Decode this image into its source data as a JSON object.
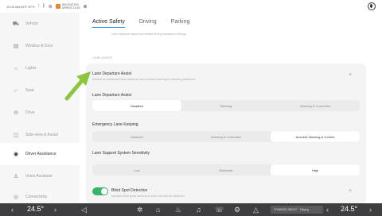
{
  "status_bar": {
    "time_info": "10:30 AM 68°F 87% ",
    "nav_line1": "NAVIGATION",
    "nav_line2": "ARRIVE 10:52"
  },
  "sidebar": {
    "items": [
      {
        "label": "Vehicle",
        "icon": "car-icon"
      },
      {
        "label": "Window & Door",
        "icon": "window-icon"
      },
      {
        "label": "Lights",
        "icon": "light-icon"
      },
      {
        "label": "Seat",
        "icon": "seat-icon"
      },
      {
        "label": "Drive",
        "icon": "steering-icon"
      },
      {
        "label": "Side-view & Assist",
        "icon": "camera-icon"
      },
      {
        "label": "Driver Assistance",
        "icon": "assist-icon",
        "active": true
      },
      {
        "label": "Voice Assistant",
        "icon": "voice-icon"
      },
      {
        "label": "Connectivity",
        "icon": "wifi-icon"
      }
    ]
  },
  "tabs": [
    "Active Safety",
    "Driving",
    "Parking"
  ],
  "tab_desc": "Lane departure assist and related driving assistance settings",
  "section_label": "LANE ASSIST",
  "ldw": {
    "title": "Lane Departure Assist",
    "desc": "Detects an unintended lane departure and provides warnings or steering assistance",
    "plus": "+"
  },
  "rows": [
    {
      "title": "Lane Departure Assist",
      "options": [
        "Disabled",
        "Warning",
        "Warning & Correction"
      ],
      "selected": 0
    },
    {
      "title": "Emergency Lane Keeping",
      "options": [
        "Disabled",
        "Warning & Correction",
        "Acoustic Warning & Correct"
      ],
      "selected": 2
    },
    {
      "title": "Lane Support System Sensitivity",
      "options": [
        "Low",
        "Moderate",
        "High"
      ],
      "selected": 2
    }
  ],
  "bsd": {
    "title": "Blind Spot Detection",
    "desc": "Monitors blind spots and warns when vehicles are detected",
    "plus": "+",
    "on": true
  },
  "dock": {
    "temp_left": "24.5°",
    "temp_right": "24.5°",
    "media_title": "THINKING ABOUT",
    "media_sub": "Playing"
  },
  "colors": {
    "accent": "#2d8cf0",
    "toggle_on": "#3ab36a",
    "arrow": "#8cc63f",
    "dock_bg": "#3e3e42"
  }
}
